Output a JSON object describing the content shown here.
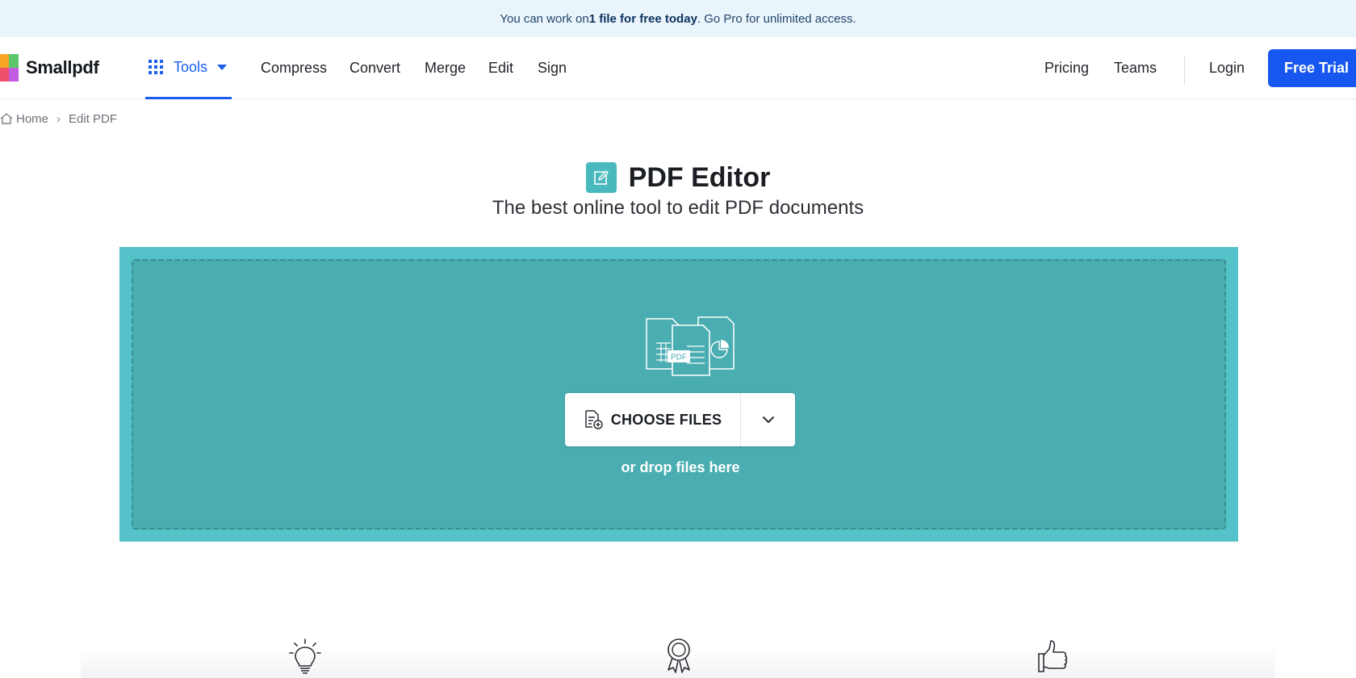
{
  "banner": {
    "prefix": "You can work on ",
    "highlight": "1 file for free today",
    "suffix": ". Go Pro for unlimited access."
  },
  "header": {
    "logo_text": "Smallpdf",
    "tools_label": "Tools",
    "nav": [
      "Compress",
      "Convert",
      "Merge",
      "Edit",
      "Sign"
    ],
    "right_nav": [
      "Pricing",
      "Teams"
    ],
    "login_label": "Login",
    "free_trial_label": "Free Trial"
  },
  "breadcrumb": {
    "home": "Home",
    "separator": "›",
    "current": "Edit PDF"
  },
  "hero": {
    "title": "PDF Editor",
    "subtitle": "The best online tool to edit PDF documents"
  },
  "dropzone": {
    "choose_files_label": "CHOOSE FILES",
    "drop_hint": "or drop files here",
    "illustration_badge": "PDF"
  },
  "features": {
    "icons": [
      "lightbulb-icon",
      "award-ribbon-icon",
      "thumbs-up-icon"
    ]
  },
  "colors": {
    "accent_blue": "#1757f0",
    "dropzone_outer": "#54c2c8",
    "dropzone_inner": "#4aadb1",
    "banner_bg": "#eaf4fb",
    "title_icon_bg": "#49b9be"
  }
}
